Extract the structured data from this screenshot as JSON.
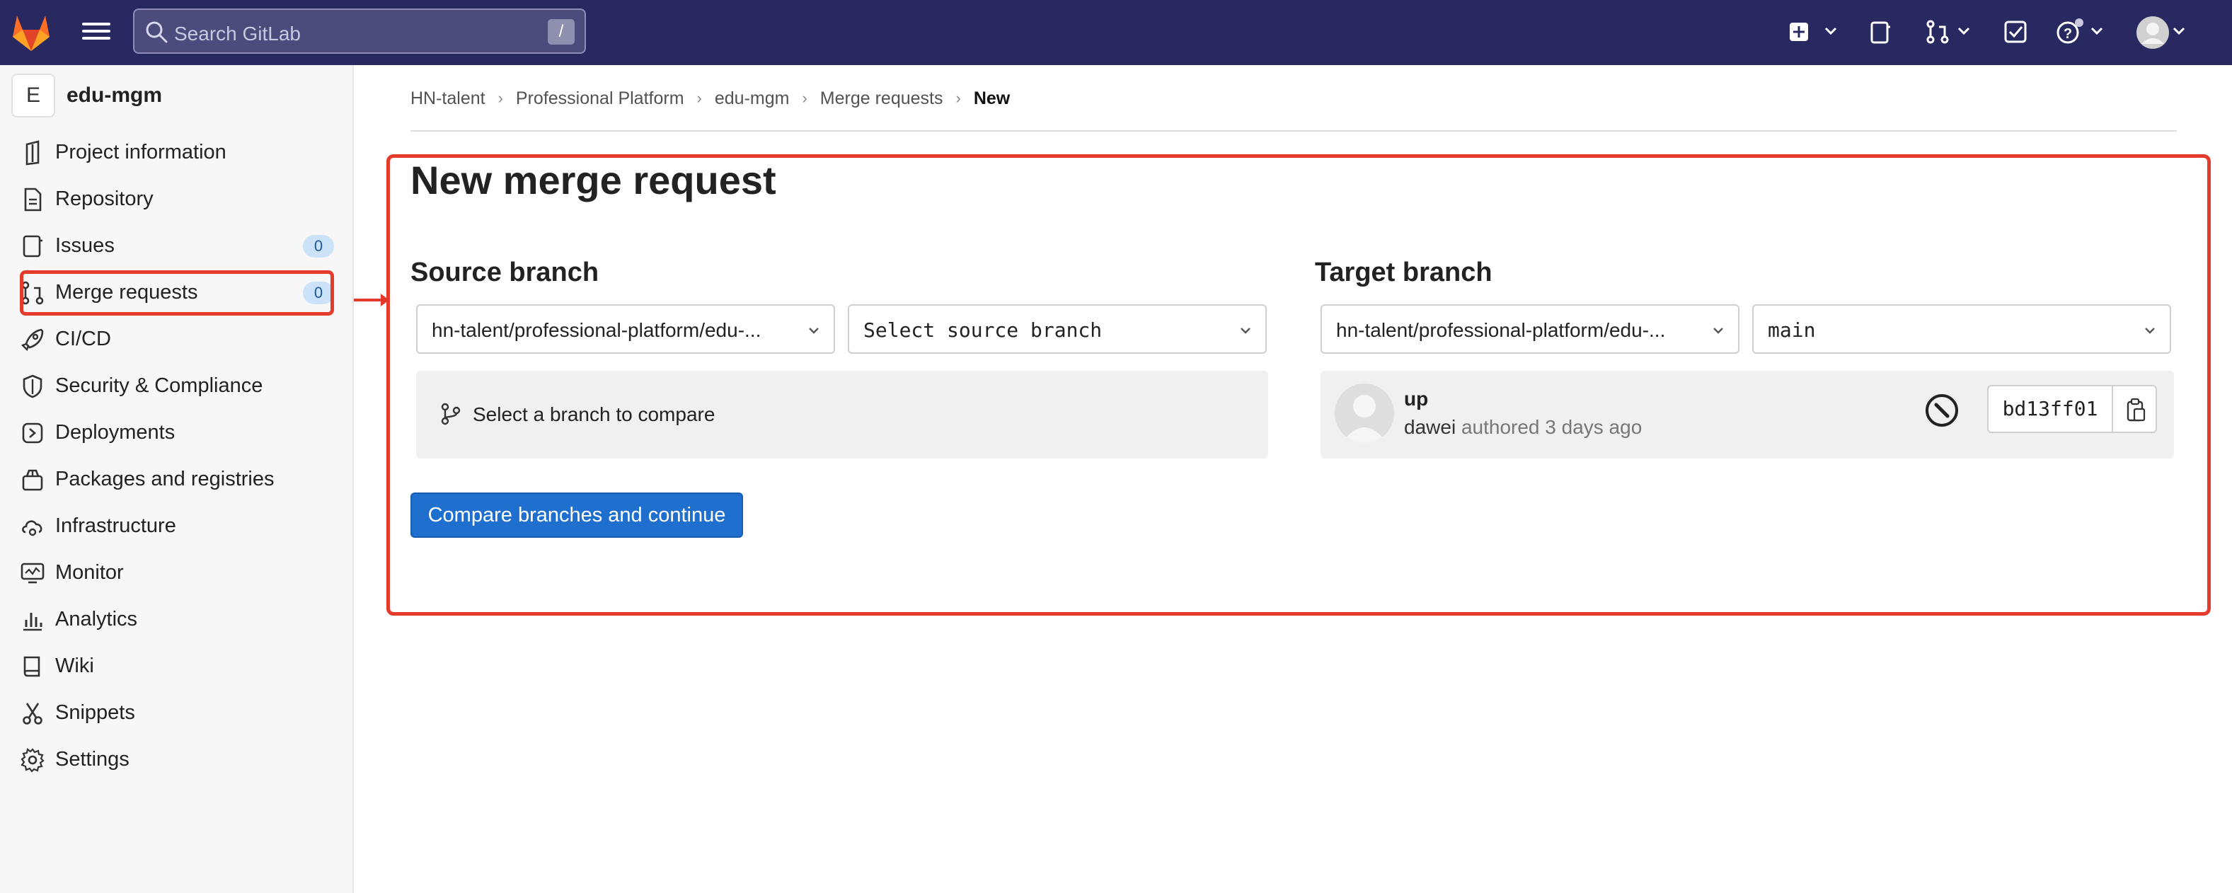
{
  "topbar": {
    "search_placeholder": "Search GitLab",
    "search_shortcut": "/",
    "icons": [
      "gitlab-logo",
      "hamburger-icon",
      "search-icon",
      "new-item-icon",
      "todo-tab-icon",
      "merge-requests-icon",
      "todo-check-icon",
      "help-icon",
      "user-avatar"
    ],
    "brand_color": "#292961"
  },
  "sidebar": {
    "project_initial": "E",
    "project_name": "edu-mgm",
    "items": [
      {
        "label": "Project information",
        "icon": "project-info-icon"
      },
      {
        "label": "Repository",
        "icon": "document-icon"
      },
      {
        "label": "Issues",
        "icon": "issues-icon",
        "badge": "0"
      },
      {
        "label": "Merge requests",
        "icon": "merge-request-icon",
        "badge": "0"
      },
      {
        "label": "CI/CD",
        "icon": "rocket-icon"
      },
      {
        "label": "Security & Compliance",
        "icon": "shield-icon"
      },
      {
        "label": "Deployments",
        "icon": "deployments-icon"
      },
      {
        "label": "Packages and registries",
        "icon": "package-icon"
      },
      {
        "label": "Infrastructure",
        "icon": "cloud-gear-icon"
      },
      {
        "label": "Monitor",
        "icon": "monitor-icon"
      },
      {
        "label": "Analytics",
        "icon": "analytics-icon"
      },
      {
        "label": "Wiki",
        "icon": "book-icon"
      },
      {
        "label": "Snippets",
        "icon": "scissors-icon"
      },
      {
        "label": "Settings",
        "icon": "gear-icon"
      }
    ]
  },
  "breadcrumb": [
    "HN-talent",
    "Professional Platform",
    "edu-mgm",
    "Merge requests",
    "New"
  ],
  "main": {
    "title": "New merge request",
    "source": {
      "heading": "Source branch",
      "project_select": "hn-talent/professional-platform/edu-...",
      "branch_select": "Select source branch",
      "compare_hint": "Select a branch to compare"
    },
    "target": {
      "heading": "Target branch",
      "project_select": "hn-talent/professional-platform/edu-...",
      "branch_select": "main",
      "commit": {
        "title": "up",
        "author": "dawei",
        "authored_text": "authored 3 days ago",
        "sha": "bd13ff01"
      }
    },
    "compare_button": "Compare branches and continue"
  },
  "colors": {
    "accent": "#1f6fcf",
    "annotation": "#e53b2c",
    "badge_bg": "#cbe2f9"
  }
}
